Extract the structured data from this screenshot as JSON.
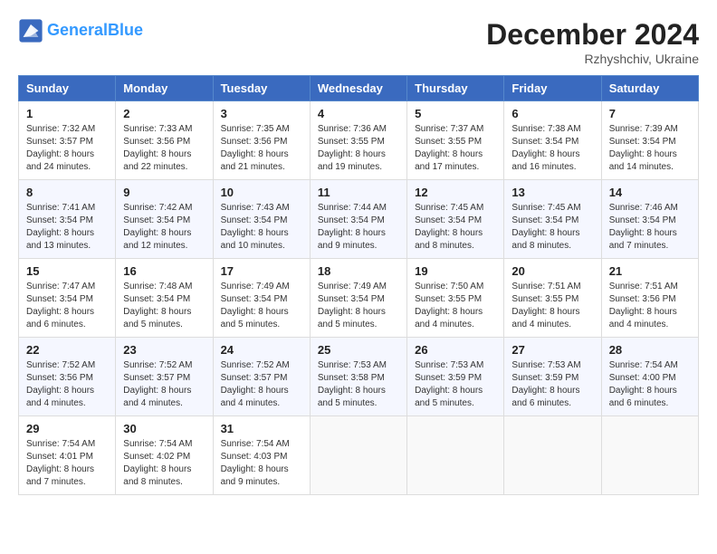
{
  "header": {
    "logo_line1": "General",
    "logo_line2": "Blue",
    "month": "December 2024",
    "location": "Rzhyshchiv, Ukraine"
  },
  "weekdays": [
    "Sunday",
    "Monday",
    "Tuesday",
    "Wednesday",
    "Thursday",
    "Friday",
    "Saturday"
  ],
  "weeks": [
    [
      {
        "day": "1",
        "sunrise": "Sunrise: 7:32 AM",
        "sunset": "Sunset: 3:57 PM",
        "daylight": "Daylight: 8 hours and 24 minutes."
      },
      {
        "day": "2",
        "sunrise": "Sunrise: 7:33 AM",
        "sunset": "Sunset: 3:56 PM",
        "daylight": "Daylight: 8 hours and 22 minutes."
      },
      {
        "day": "3",
        "sunrise": "Sunrise: 7:35 AM",
        "sunset": "Sunset: 3:56 PM",
        "daylight": "Daylight: 8 hours and 21 minutes."
      },
      {
        "day": "4",
        "sunrise": "Sunrise: 7:36 AM",
        "sunset": "Sunset: 3:55 PM",
        "daylight": "Daylight: 8 hours and 19 minutes."
      },
      {
        "day": "5",
        "sunrise": "Sunrise: 7:37 AM",
        "sunset": "Sunset: 3:55 PM",
        "daylight": "Daylight: 8 hours and 17 minutes."
      },
      {
        "day": "6",
        "sunrise": "Sunrise: 7:38 AM",
        "sunset": "Sunset: 3:54 PM",
        "daylight": "Daylight: 8 hours and 16 minutes."
      },
      {
        "day": "7",
        "sunrise": "Sunrise: 7:39 AM",
        "sunset": "Sunset: 3:54 PM",
        "daylight": "Daylight: 8 hours and 14 minutes."
      }
    ],
    [
      {
        "day": "8",
        "sunrise": "Sunrise: 7:41 AM",
        "sunset": "Sunset: 3:54 PM",
        "daylight": "Daylight: 8 hours and 13 minutes."
      },
      {
        "day": "9",
        "sunrise": "Sunrise: 7:42 AM",
        "sunset": "Sunset: 3:54 PM",
        "daylight": "Daylight: 8 hours and 12 minutes."
      },
      {
        "day": "10",
        "sunrise": "Sunrise: 7:43 AM",
        "sunset": "Sunset: 3:54 PM",
        "daylight": "Daylight: 8 hours and 10 minutes."
      },
      {
        "day": "11",
        "sunrise": "Sunrise: 7:44 AM",
        "sunset": "Sunset: 3:54 PM",
        "daylight": "Daylight: 8 hours and 9 minutes."
      },
      {
        "day": "12",
        "sunrise": "Sunrise: 7:45 AM",
        "sunset": "Sunset: 3:54 PM",
        "daylight": "Daylight: 8 hours and 8 minutes."
      },
      {
        "day": "13",
        "sunrise": "Sunrise: 7:45 AM",
        "sunset": "Sunset: 3:54 PM",
        "daylight": "Daylight: 8 hours and 8 minutes."
      },
      {
        "day": "14",
        "sunrise": "Sunrise: 7:46 AM",
        "sunset": "Sunset: 3:54 PM",
        "daylight": "Daylight: 8 hours and 7 minutes."
      }
    ],
    [
      {
        "day": "15",
        "sunrise": "Sunrise: 7:47 AM",
        "sunset": "Sunset: 3:54 PM",
        "daylight": "Daylight: 8 hours and 6 minutes."
      },
      {
        "day": "16",
        "sunrise": "Sunrise: 7:48 AM",
        "sunset": "Sunset: 3:54 PM",
        "daylight": "Daylight: 8 hours and 5 minutes."
      },
      {
        "day": "17",
        "sunrise": "Sunrise: 7:49 AM",
        "sunset": "Sunset: 3:54 PM",
        "daylight": "Daylight: 8 hours and 5 minutes."
      },
      {
        "day": "18",
        "sunrise": "Sunrise: 7:49 AM",
        "sunset": "Sunset: 3:54 PM",
        "daylight": "Daylight: 8 hours and 5 minutes."
      },
      {
        "day": "19",
        "sunrise": "Sunrise: 7:50 AM",
        "sunset": "Sunset: 3:55 PM",
        "daylight": "Daylight: 8 hours and 4 minutes."
      },
      {
        "day": "20",
        "sunrise": "Sunrise: 7:51 AM",
        "sunset": "Sunset: 3:55 PM",
        "daylight": "Daylight: 8 hours and 4 minutes."
      },
      {
        "day": "21",
        "sunrise": "Sunrise: 7:51 AM",
        "sunset": "Sunset: 3:56 PM",
        "daylight": "Daylight: 8 hours and 4 minutes."
      }
    ],
    [
      {
        "day": "22",
        "sunrise": "Sunrise: 7:52 AM",
        "sunset": "Sunset: 3:56 PM",
        "daylight": "Daylight: 8 hours and 4 minutes."
      },
      {
        "day": "23",
        "sunrise": "Sunrise: 7:52 AM",
        "sunset": "Sunset: 3:57 PM",
        "daylight": "Daylight: 8 hours and 4 minutes."
      },
      {
        "day": "24",
        "sunrise": "Sunrise: 7:52 AM",
        "sunset": "Sunset: 3:57 PM",
        "daylight": "Daylight: 8 hours and 4 minutes."
      },
      {
        "day": "25",
        "sunrise": "Sunrise: 7:53 AM",
        "sunset": "Sunset: 3:58 PM",
        "daylight": "Daylight: 8 hours and 5 minutes."
      },
      {
        "day": "26",
        "sunrise": "Sunrise: 7:53 AM",
        "sunset": "Sunset: 3:59 PM",
        "daylight": "Daylight: 8 hours and 5 minutes."
      },
      {
        "day": "27",
        "sunrise": "Sunrise: 7:53 AM",
        "sunset": "Sunset: 3:59 PM",
        "daylight": "Daylight: 8 hours and 6 minutes."
      },
      {
        "day": "28",
        "sunrise": "Sunrise: 7:54 AM",
        "sunset": "Sunset: 4:00 PM",
        "daylight": "Daylight: 8 hours and 6 minutes."
      }
    ],
    [
      {
        "day": "29",
        "sunrise": "Sunrise: 7:54 AM",
        "sunset": "Sunset: 4:01 PM",
        "daylight": "Daylight: 8 hours and 7 minutes."
      },
      {
        "day": "30",
        "sunrise": "Sunrise: 7:54 AM",
        "sunset": "Sunset: 4:02 PM",
        "daylight": "Daylight: 8 hours and 8 minutes."
      },
      {
        "day": "31",
        "sunrise": "Sunrise: 7:54 AM",
        "sunset": "Sunset: 4:03 PM",
        "daylight": "Daylight: 8 hours and 9 minutes."
      },
      null,
      null,
      null,
      null
    ]
  ]
}
